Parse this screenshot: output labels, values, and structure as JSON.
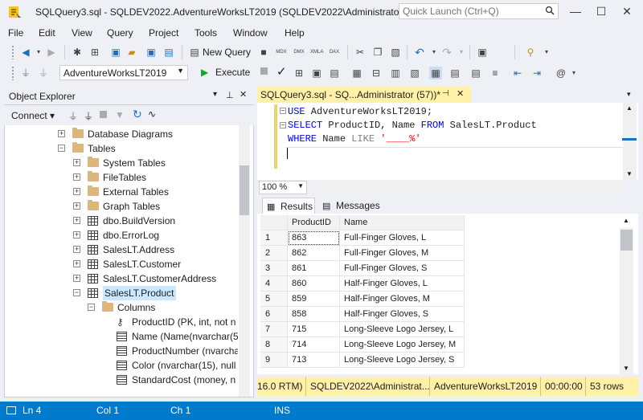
{
  "window": {
    "title": "SQLQuery3.sql - SQLDEV2022.AdventureWorksLT2019 (SQLDEV2022\\Administrator (...",
    "quick_launch_placeholder": "Quick Launch (Ctrl+Q)"
  },
  "menu": [
    "File",
    "Edit",
    "View",
    "Query",
    "Project",
    "Tools",
    "Window",
    "Help"
  ],
  "toolbar": {
    "new_query_label": "New Query",
    "database": "AdventureWorksLT2019",
    "execute_label": "Execute",
    "mini_labels": [
      "MDX",
      "DMX",
      "XMLA",
      "DAX"
    ]
  },
  "object_explorer": {
    "title": "Object Explorer",
    "connect_label": "Connect",
    "tree": [
      {
        "label": "Database Diagrams",
        "expander": "+",
        "icon": "folder",
        "indent": 0
      },
      {
        "label": "Tables",
        "expander": "−",
        "icon": "folder",
        "indent": 0
      },
      {
        "label": "System Tables",
        "expander": "+",
        "icon": "folder",
        "indent": 1
      },
      {
        "label": "FileTables",
        "expander": "+",
        "icon": "folder",
        "indent": 1
      },
      {
        "label": "External Tables",
        "expander": "+",
        "icon": "folder",
        "indent": 1
      },
      {
        "label": "Graph Tables",
        "expander": "+",
        "icon": "folder",
        "indent": 1
      },
      {
        "label": "dbo.BuildVersion",
        "expander": "+",
        "icon": "table",
        "indent": 1
      },
      {
        "label": "dbo.ErrorLog",
        "expander": "+",
        "icon": "table",
        "indent": 1
      },
      {
        "label": "SalesLT.Address",
        "expander": "+",
        "icon": "table",
        "indent": 1
      },
      {
        "label": "SalesLT.Customer",
        "expander": "+",
        "icon": "table",
        "indent": 1
      },
      {
        "label": "SalesLT.CustomerAddress",
        "expander": "+",
        "icon": "table",
        "indent": 1
      },
      {
        "label": "SalesLT.Product",
        "expander": "−",
        "icon": "table",
        "indent": 1,
        "selected": true
      },
      {
        "label": "Columns",
        "expander": "−",
        "icon": "folder",
        "indent": 2
      },
      {
        "label": "ProductID (PK, int, not n",
        "expander": "",
        "icon": "key",
        "indent": 3
      },
      {
        "label": "Name (Name(nvarchar(5",
        "expander": "",
        "icon": "column",
        "indent": 3
      },
      {
        "label": "ProductNumber (nvarcha",
        "expander": "",
        "icon": "column",
        "indent": 3
      },
      {
        "label": "Color (nvarchar(15), null",
        "expander": "",
        "icon": "column",
        "indent": 3
      },
      {
        "label": "StandardCost (money, n",
        "expander": "",
        "icon": "column",
        "indent": 3
      }
    ]
  },
  "editor": {
    "tab_title": "SQLQuery3.sql - SQ...Administrator (57))*",
    "line1_kw": "USE",
    "line1_rest": " AdventureWorksLT2019;",
    "line2_kw1": "SELECT",
    "line2_mid": " ProductID, Name ",
    "line2_kw2": "FROM",
    "line2_rest": " SalesLT.Product",
    "line3_kw1": "WHERE",
    "line3_mid": " Name ",
    "line3_kw2": "LIKE",
    "line3_str": " '____%'",
    "zoom": "100 %"
  },
  "results": {
    "results_tab": "Results",
    "messages_tab": "Messages",
    "columns": [
      "ProductID",
      "Name"
    ],
    "rows": [
      [
        "1",
        "863",
        "Full-Finger Gloves, L"
      ],
      [
        "2",
        "862",
        "Full-Finger Gloves, M"
      ],
      [
        "3",
        "861",
        "Full-Finger Gloves, S"
      ],
      [
        "4",
        "860",
        "Half-Finger Gloves, L"
      ],
      [
        "5",
        "859",
        "Half-Finger Gloves, M"
      ],
      [
        "6",
        "858",
        "Half-Finger Gloves, S"
      ],
      [
        "7",
        "715",
        "Long-Sleeve Logo Jersey, L"
      ],
      [
        "8",
        "714",
        "Long-Sleeve Logo Jersey, M"
      ],
      [
        "9",
        "713",
        "Long-Sleeve Logo Jersey, S"
      ]
    ]
  },
  "query_status": {
    "version": "16.0 RTM)",
    "server_user": "SQLDEV2022\\Administrat...",
    "database": "AdventureWorksLT2019",
    "elapsed": "00:00:00",
    "rows": "53 rows",
    "color": "#fff1a8"
  },
  "status_bar": {
    "ln": "Ln 4",
    "col": "Col 1",
    "ch": "Ch 1",
    "mode": "INS",
    "color": "#007acc"
  }
}
